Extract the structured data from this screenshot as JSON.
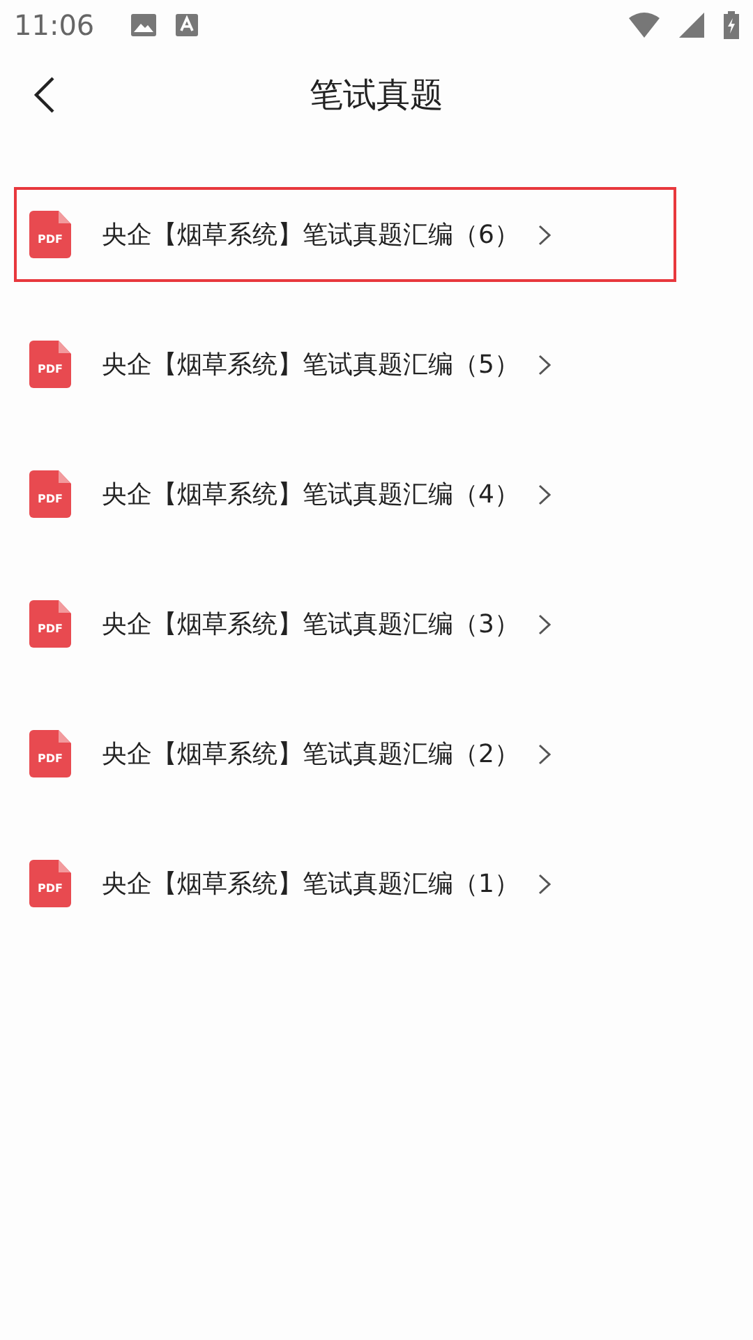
{
  "status_bar": {
    "time": "11:06"
  },
  "header": {
    "title": "笔试真题"
  },
  "files": [
    {
      "badge": "PDF",
      "name": "央企【烟草系统】笔试真题汇编（6）",
      "highlighted": true
    },
    {
      "badge": "PDF",
      "name": "央企【烟草系统】笔试真题汇编（5）",
      "highlighted": false
    },
    {
      "badge": "PDF",
      "name": "央企【烟草系统】笔试真题汇编（4）",
      "highlighted": false
    },
    {
      "badge": "PDF",
      "name": "央企【烟草系统】笔试真题汇编（3）",
      "highlighted": false
    },
    {
      "badge": "PDF",
      "name": "央企【烟草系统】笔试真题汇编（2）",
      "highlighted": false
    },
    {
      "badge": "PDF",
      "name": "央企【烟草系统】笔试真题汇编（1）",
      "highlighted": false
    }
  ]
}
